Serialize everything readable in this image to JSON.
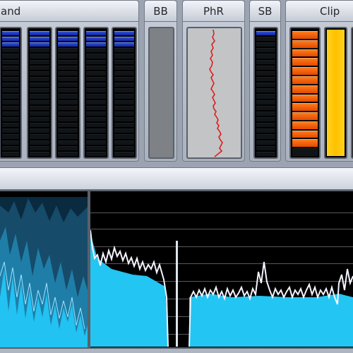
{
  "panels": {
    "band": {
      "label": "and",
      "meter_count": 5,
      "segments": 22,
      "lit": [
        3,
        3,
        3,
        3,
        3
      ]
    },
    "bb": {
      "label": "BB"
    },
    "phr": {
      "label": "PhR"
    },
    "sb": {
      "label": "SB",
      "segments": 22,
      "lit": 1
    },
    "clip": {
      "label": "Clip",
      "orange_segments": 14,
      "yellow_level": 1.0,
      "orange_level": 0.95
    }
  },
  "colors": {
    "meter_blue": "#1f3cc2",
    "clip_orange": "#ff6a00",
    "clip_yellow": "#ffcb05",
    "phase_trace": "#e21b1b",
    "spectrum_cyan": "#1bc4f0",
    "spectrum_white": "#f3f3ff"
  }
}
